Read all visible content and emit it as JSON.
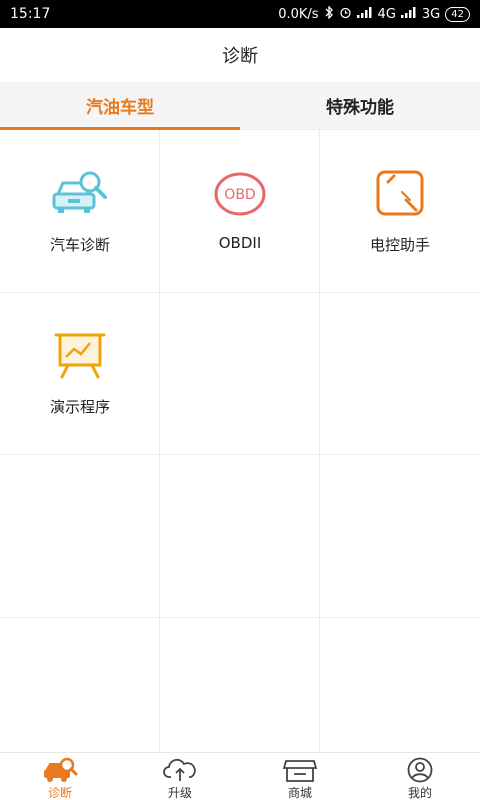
{
  "status_bar": {
    "time": "15:17",
    "speed": "0.0K/s",
    "network1": "4G",
    "network2": "3G",
    "battery": "42"
  },
  "header": {
    "title": "诊断"
  },
  "tabs": [
    {
      "label": "汽油车型",
      "active": true
    },
    {
      "label": "特殊功能",
      "active": false
    }
  ],
  "grid": {
    "items": [
      {
        "label": "汽车诊断",
        "icon": "car-search-icon",
        "color": "#5bc3d8"
      },
      {
        "label": "OBDII",
        "icon": "obd-icon",
        "color": "#e8676a",
        "icon_text": "OBD"
      },
      {
        "label": "电控助手",
        "icon": "ecu-assistant-icon",
        "color": "#e8791d"
      },
      {
        "label": "演示程序",
        "icon": "presentation-board-icon",
        "color": "#f0a30a"
      }
    ]
  },
  "bottom_nav": {
    "accent": "#e8791d",
    "items": [
      {
        "label": "诊断",
        "icon": "car-diagnose-icon",
        "active": true
      },
      {
        "label": "升级",
        "icon": "cloud-upgrade-icon",
        "active": false
      },
      {
        "label": "商城",
        "icon": "store-icon",
        "active": false
      },
      {
        "label": "我的",
        "icon": "user-profile-icon",
        "active": false
      }
    ]
  }
}
